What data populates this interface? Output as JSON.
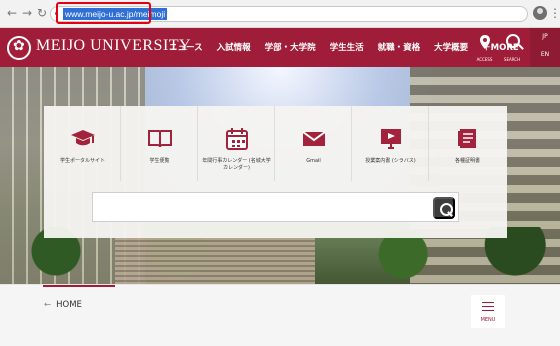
{
  "browser": {
    "url": "www.meijo-u.ac.jp/meimoji",
    "back_icon": "arrow-left-icon",
    "forward_icon": "arrow-right-icon",
    "reload_icon": "reload-icon"
  },
  "header": {
    "site_name": "MEIJO UNIVERSITY",
    "nav": [
      "ニュース",
      "入試情報",
      "学部・大学院",
      "学生生活",
      "就職・資格",
      "大学概要",
      "＋MORE"
    ],
    "access_label": "ACCESS",
    "search_label": "SEARCH",
    "lang_jp": "JP",
    "lang_en": "EN"
  },
  "quick_links": [
    {
      "label": "学生ポータルサイト",
      "icon": "graduation-cap-icon"
    },
    {
      "label": "学生便覧",
      "icon": "book-icon"
    },
    {
      "label": "年間行事カレンダー\n(名城大学カレンダー)",
      "icon": "calendar-icon"
    },
    {
      "label": "Gmail",
      "icon": "mail-icon"
    },
    {
      "label": "授業案内書\n(シラバス)",
      "icon": "presentation-icon"
    },
    {
      "label": "各種証明書",
      "icon": "certificate-icon"
    }
  ],
  "search": {
    "placeholder": ""
  },
  "footer": {
    "home_label": "HOME",
    "menu_label": "MENU"
  },
  "colors": {
    "brand": "#9f1d38",
    "highlight": "#e60012"
  }
}
